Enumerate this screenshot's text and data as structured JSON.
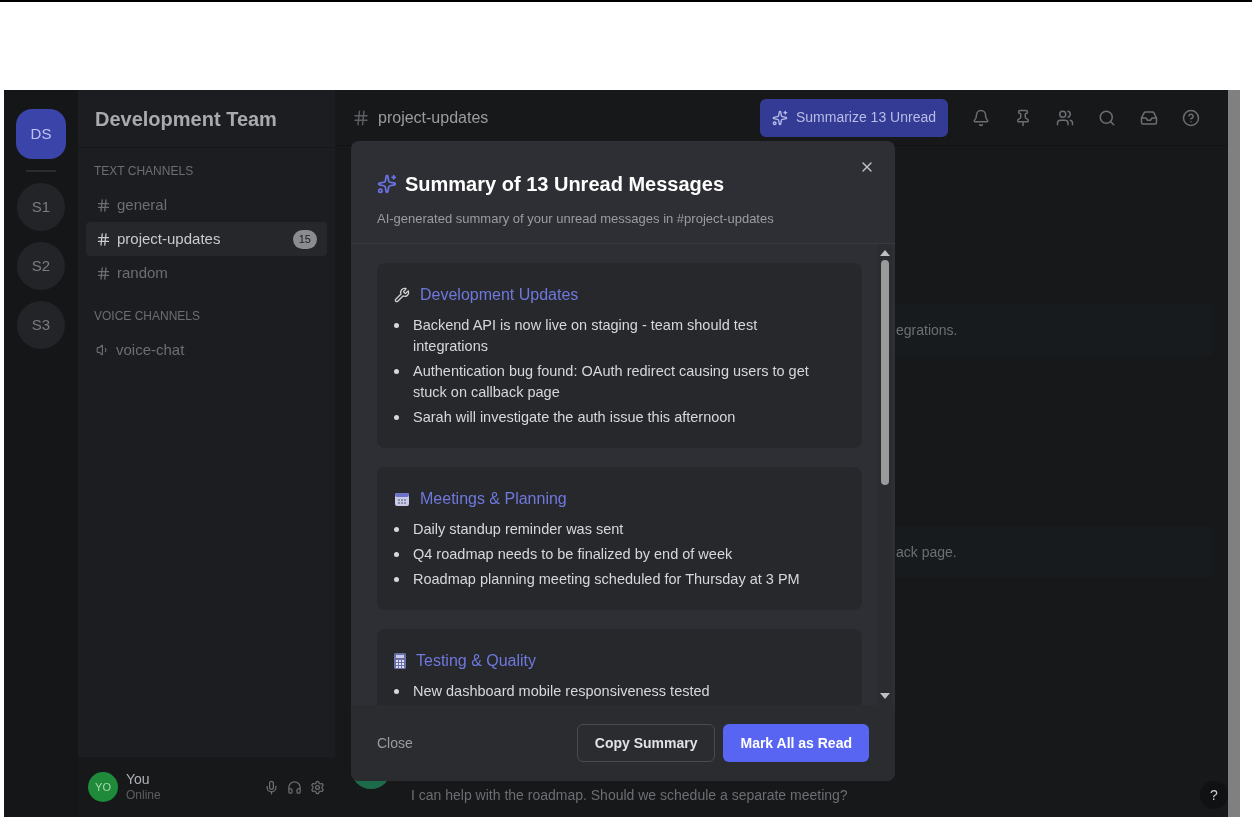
{
  "servers": [
    {
      "label": "DS",
      "selected": true
    },
    {
      "label": "S1",
      "selected": false
    },
    {
      "label": "S2",
      "selected": false
    },
    {
      "label": "S3",
      "selected": false
    }
  ],
  "sidebar": {
    "title": "Development Team",
    "sections": [
      {
        "heading": "TEXT CHANNELS",
        "channels": [
          {
            "kind": "text",
            "name": "general",
            "selected": false
          },
          {
            "kind": "text",
            "name": "project-updates",
            "selected": true,
            "badge": "15"
          },
          {
            "kind": "text",
            "name": "random",
            "selected": false
          }
        ]
      },
      {
        "heading": "VOICE CHANNELS",
        "channels": [
          {
            "kind": "voice",
            "name": "voice-chat",
            "selected": false
          }
        ]
      }
    ]
  },
  "user": {
    "avatar": "YO",
    "name": "You",
    "status": "Online"
  },
  "header": {
    "channel": "project-updates",
    "summarize_button": "Summarize 13 Unread"
  },
  "messages": [
    {
      "text": "egrations."
    },
    {
      "text": "ack page."
    }
  ],
  "last_message": {
    "text": "I can help with the roadmap. Should we schedule a separate meeting?"
  },
  "modal": {
    "title": "Summary of 13 Unread Messages",
    "subtitle": "AI-generated summary of your unread messages in #project-updates",
    "sections": [
      {
        "kind": "wrench",
        "heading": "Development Updates",
        "bullets": [
          "Backend API is now live on staging - team should test integrations",
          "Authentication bug found: OAuth redirect causing users to get stuck on callback page",
          "Sarah will investigate the auth issue this afternoon"
        ]
      },
      {
        "kind": "calendar",
        "heading": "Meetings & Planning",
        "bullets": [
          "Daily standup reminder was sent",
          "Q4 roadmap needs to be finalized by end of week",
          "Roadmap planning meeting scheduled for Thursday at 3 PM"
        ]
      },
      {
        "kind": "device",
        "heading": "Testing & Quality",
        "bullets": [
          "New dashboard mobile responsiveness tested"
        ]
      }
    ],
    "close_link": "Close",
    "copy_button": "Copy Summary",
    "mark_button": "Mark All as Read"
  },
  "help_button": "?"
}
